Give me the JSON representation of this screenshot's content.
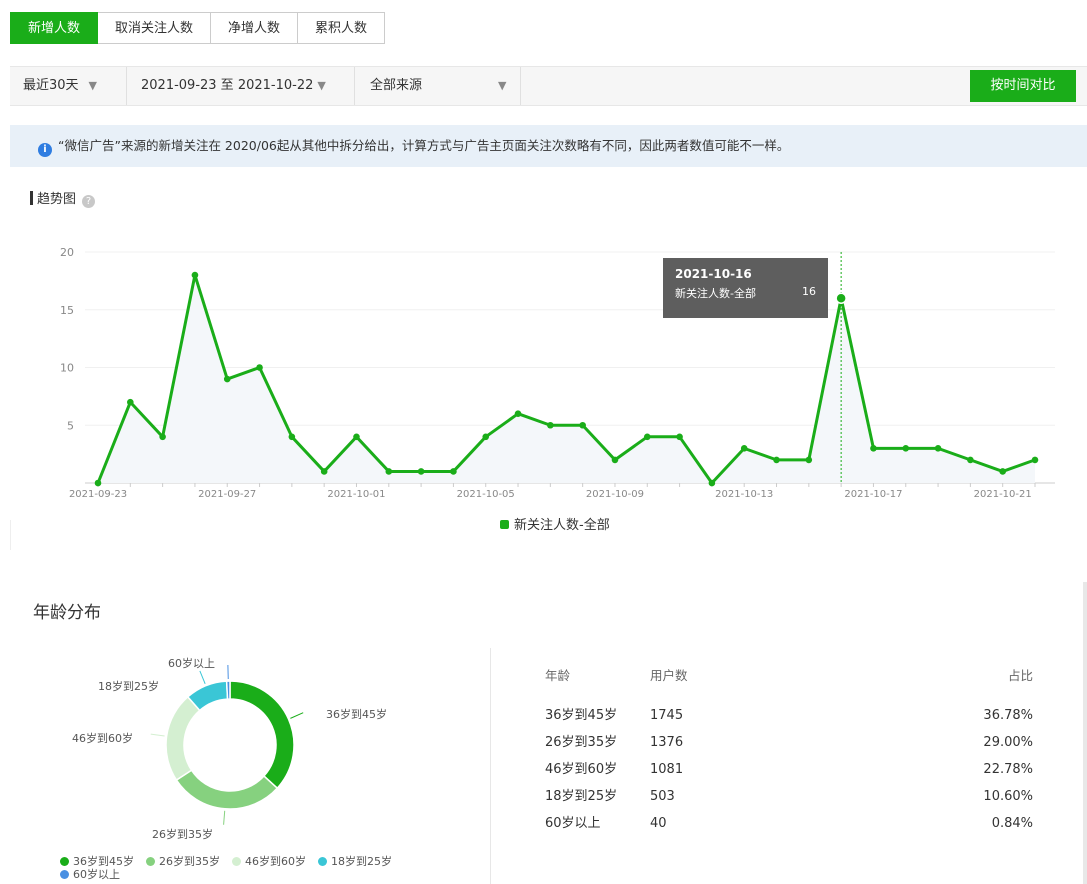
{
  "tabs": [
    {
      "label": "新增人数",
      "active": true
    },
    {
      "label": "取消关注人数",
      "active": false
    },
    {
      "label": "净增人数",
      "active": false
    },
    {
      "label": "累积人数",
      "active": false
    }
  ],
  "filters": {
    "range": "最近30天",
    "dates": "2021-09-23 至 2021-10-22",
    "source": "全部来源",
    "compare_button": "按时间对比"
  },
  "notice": "“微信广告”来源的新增关注在 2020/06起从其他中拆分给出，计算方式与广告主页面关注次数略有不同，因此两者数值可能不一样。",
  "trend": {
    "title": "趋势图",
    "tooltip": {
      "date": "2021-10-16",
      "series": "新关注人数-全部",
      "value": "16"
    },
    "legend": "新关注人数-全部"
  },
  "chart_data": [
    {
      "type": "line",
      "title": "趋势图",
      "x": [
        "2021-09-23",
        "2021-09-24",
        "2021-09-25",
        "2021-09-26",
        "2021-09-27",
        "2021-09-28",
        "2021-09-29",
        "2021-09-30",
        "2021-10-01",
        "2021-10-02",
        "2021-10-03",
        "2021-10-04",
        "2021-10-05",
        "2021-10-06",
        "2021-10-07",
        "2021-10-08",
        "2021-10-09",
        "2021-10-10",
        "2021-10-11",
        "2021-10-12",
        "2021-10-13",
        "2021-10-14",
        "2021-10-15",
        "2021-10-16",
        "2021-10-17",
        "2021-10-18",
        "2021-10-19",
        "2021-10-20",
        "2021-10-21",
        "2021-10-22"
      ],
      "xticks": [
        "2021-09-23",
        "2021-09-27",
        "2021-10-01",
        "2021-10-05",
        "2021-10-09",
        "2021-10-13",
        "2021-10-17",
        "2021-10-21"
      ],
      "yticks": [
        5,
        10,
        15,
        20
      ],
      "ylim": [
        0,
        20
      ],
      "series": [
        {
          "name": "新关注人数-全部",
          "color": "#1aad19",
          "values": [
            0,
            7,
            4,
            18,
            9,
            10,
            4,
            1,
            4,
            1,
            1,
            1,
            4,
            6,
            5,
            5,
            2,
            4,
            4,
            0,
            3,
            2,
            2,
            16,
            3,
            3,
            3,
            2,
            1,
            2
          ]
        }
      ],
      "legend": "bottom-center",
      "grid": true
    },
    {
      "type": "pie",
      "title": "年龄分布",
      "categories": [
        "36岁到45岁",
        "26岁到35岁",
        "46岁到60岁",
        "18岁到25岁",
        "60岁以上"
      ],
      "values": [
        1745,
        1376,
        1081,
        503,
        40
      ],
      "colors": [
        "#1aad19",
        "#86d17f",
        "#d4efd1",
        "#3ac6d6",
        "#4a90e2"
      ],
      "legend": "bottom-left"
    }
  ],
  "age": {
    "title": "年龄分布",
    "pie_labels": [
      "36岁到45岁",
      "26岁到35岁",
      "46岁到60岁",
      "18岁到25岁",
      "60岁以上"
    ],
    "legend": [
      "36岁到45岁",
      "26岁到35岁",
      "46岁到60岁",
      "18岁到25岁",
      "60岁以上"
    ],
    "table": {
      "headers": [
        "年龄",
        "用户数",
        "占比"
      ],
      "rows": [
        [
          "36岁到45岁",
          "1745",
          "36.78%"
        ],
        [
          "26岁到35岁",
          "1376",
          "29.00%"
        ],
        [
          "46岁到60岁",
          "1081",
          "22.78%"
        ],
        [
          "18岁到25岁",
          "503",
          "10.60%"
        ],
        [
          "60岁以上",
          "40",
          "0.84%"
        ]
      ]
    }
  }
}
